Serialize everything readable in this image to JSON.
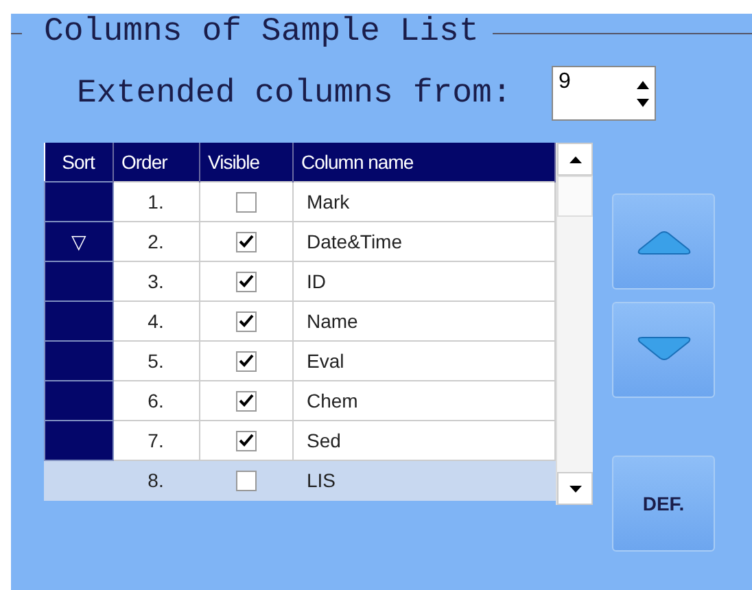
{
  "group_title": "Columns of Sample List",
  "extended_label": "Extended columns from:",
  "extended_value": "9",
  "table": {
    "columns": [
      "Sort",
      "Order",
      "Visible",
      "Column name"
    ],
    "rows": [
      {
        "sort": "",
        "order": "1.",
        "visible": false,
        "name": "Mark",
        "selected": false
      },
      {
        "sort": "▽",
        "order": "2.",
        "visible": true,
        "name": "Date&Time",
        "selected": false
      },
      {
        "sort": "",
        "order": "3.",
        "visible": true,
        "name": "ID",
        "selected": false
      },
      {
        "sort": "",
        "order": "4.",
        "visible": true,
        "name": "Name",
        "selected": false
      },
      {
        "sort": "",
        "order": "5.",
        "visible": true,
        "name": "Eval",
        "selected": false
      },
      {
        "sort": "",
        "order": "6.",
        "visible": true,
        "name": "Chem",
        "selected": false
      },
      {
        "sort": "",
        "order": "7.",
        "visible": true,
        "name": "Sed",
        "selected": false
      },
      {
        "sort": "",
        "order": "8.",
        "visible": false,
        "name": "LIS",
        "selected": true
      }
    ]
  },
  "default_button": "DEF."
}
